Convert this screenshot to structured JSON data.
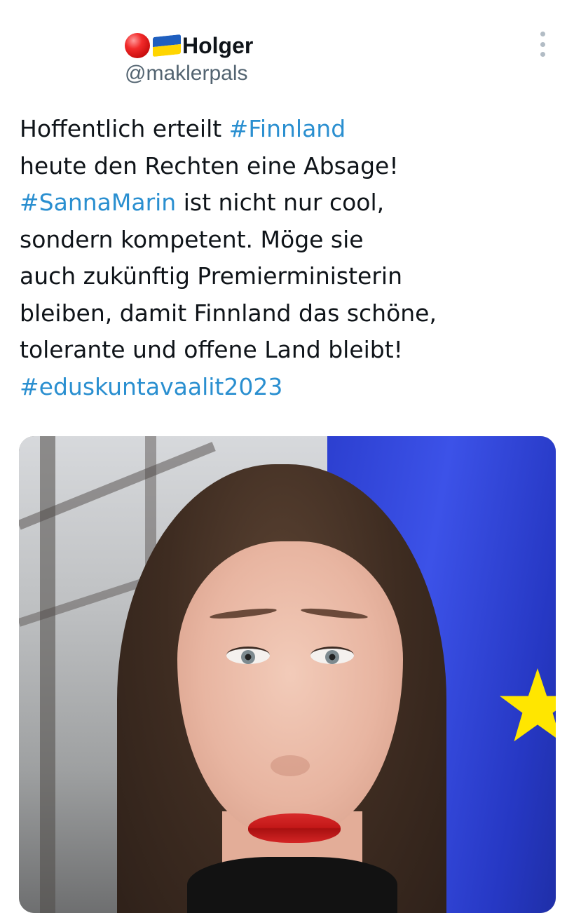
{
  "user": {
    "display_name": "Holger",
    "handle": "@maklerpals",
    "avatar_colors": {
      "top": "#1f5fbf",
      "bottom": "#ffd500"
    },
    "name_emojis": [
      "red-circle",
      "ukraine-flag"
    ]
  },
  "tweet": {
    "lines": [
      [
        {
          "text": "Hoffentlich erteilt ",
          "tag": false
        },
        {
          "text": "#Finnland",
          "tag": true
        }
      ],
      [
        {
          "text": "heute den Rechten eine Absage!",
          "tag": false
        }
      ],
      [
        {
          "text": "#SannaMarin",
          "tag": true
        },
        {
          "text": " ist nicht nur cool,",
          "tag": false
        }
      ],
      [
        {
          "text": "sondern kompetent. Möge sie",
          "tag": false
        }
      ],
      [
        {
          "text": "auch zukünftig Premierministerin",
          "tag": false
        }
      ],
      [
        {
          "text": "bleiben, damit Finnland das schöne,",
          "tag": false
        }
      ],
      [
        {
          "text": "tolerante und offene Land bleibt!",
          "tag": false
        }
      ],
      [
        {
          "text": "#eduskuntavaalit2023",
          "tag": true
        }
      ]
    ]
  },
  "colors": {
    "hashtag": "#2a8fd0",
    "text": "#0f1419",
    "secondary": "#536471"
  },
  "media": {
    "description_icon": "photo"
  }
}
